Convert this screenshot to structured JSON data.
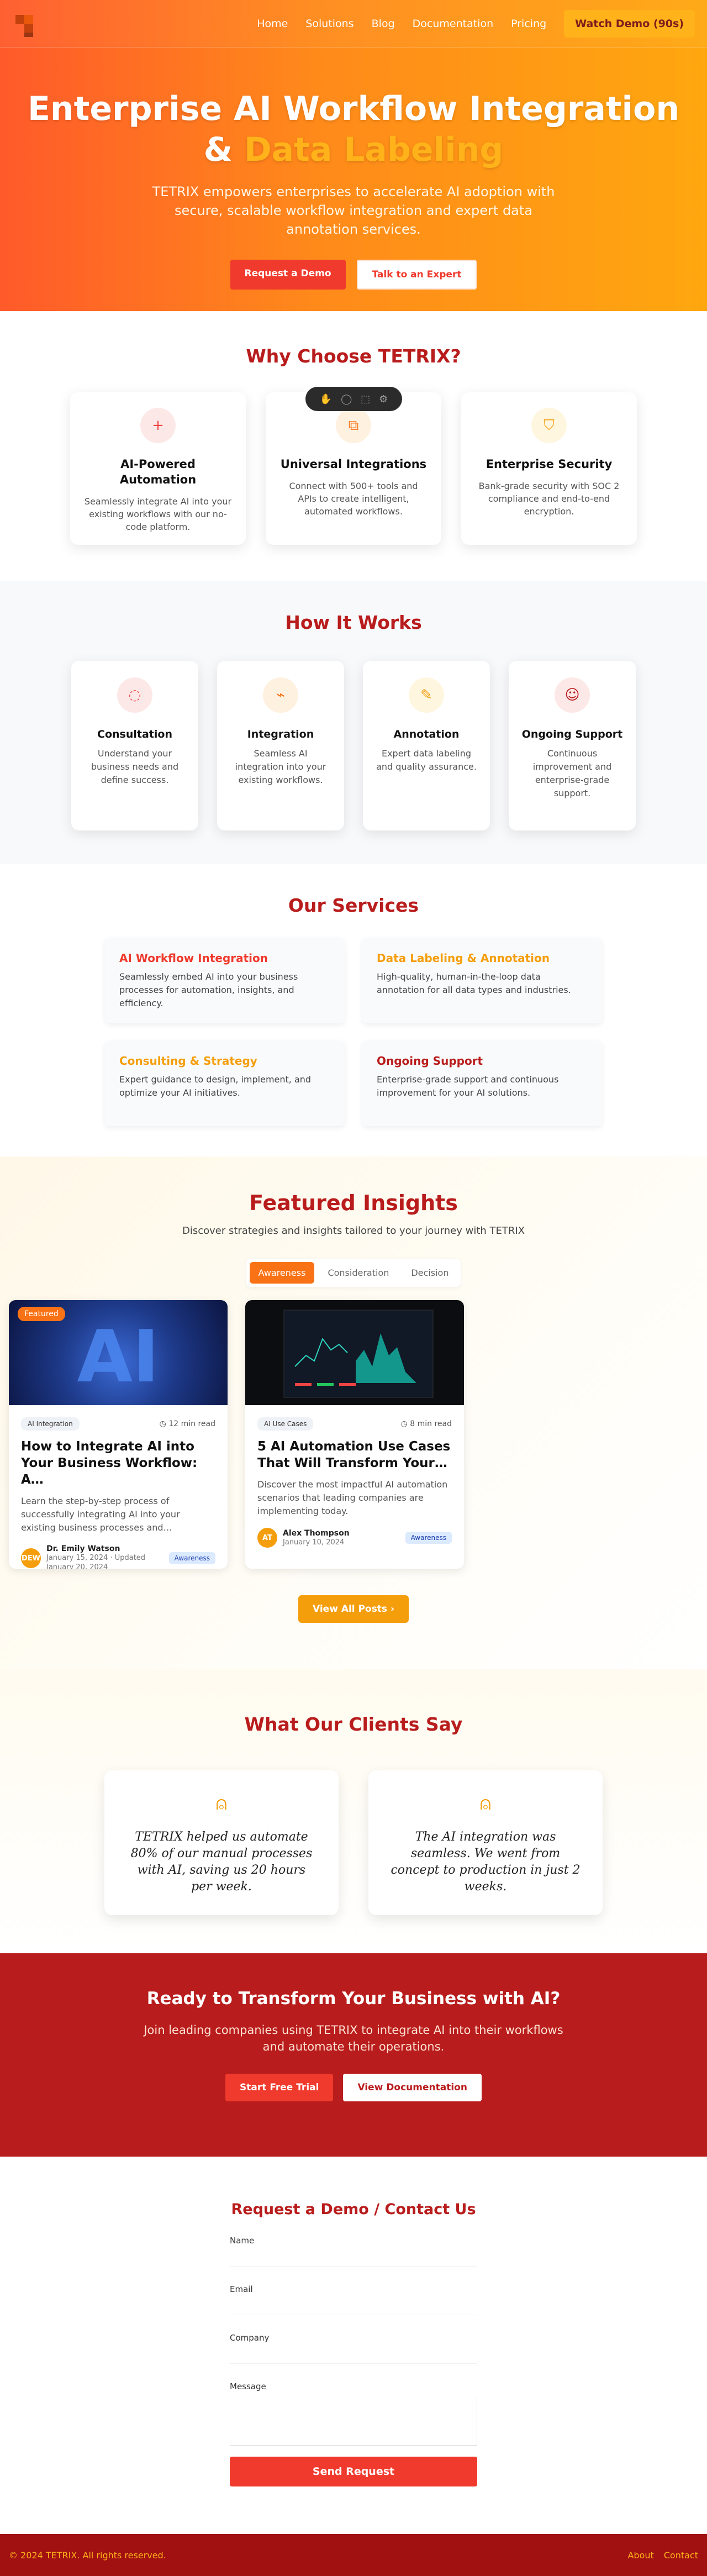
{
  "nav": {
    "links": [
      "Home",
      "Solutions",
      "Blog",
      "Documentation",
      "Pricing"
    ],
    "watch_demo": "Watch Demo (90s)"
  },
  "hero": {
    "title_line1": "Enterprise AI Workflow Integration",
    "title_amp": "&",
    "title_highlight": "Data Labeling",
    "subtitle": "TETRIX empowers enterprises to accelerate AI adoption with secure, scalable workflow integration and expert data annotation services.",
    "btn_primary": "Request a Demo",
    "btn_secondary": "Talk to an Expert"
  },
  "why": {
    "title": "Why Choose TETRIX?",
    "cards": [
      {
        "title": "AI-Powered Automation",
        "text": "Seamlessly integrate AI into your existing workflows with our no-code platform.",
        "icon": "plus-icon",
        "color": "#ef4444",
        "bg": "#fde8e8"
      },
      {
        "title": "Universal Integrations",
        "text": "Connect with 500+ tools and APIs to create intelligent, automated workflows.",
        "icon": "integrations-icon",
        "color": "#f97316",
        "bg": "#fff1e0"
      },
      {
        "title": "Enterprise Security",
        "text": "Bank-grade security with SOC 2 compliance and end-to-end encryption.",
        "icon": "shield-icon",
        "color": "#f59e0b",
        "bg": "#fff6df"
      }
    ]
  },
  "how": {
    "title": "How It Works",
    "steps": [
      {
        "title": "Consultation",
        "text": "Understand your business needs and define success.",
        "icon": "chat-icon",
        "color": "#ef4444",
        "bg": "#fde8e8"
      },
      {
        "title": "Integration",
        "text": "Seamless AI integration into your existing workflows.",
        "icon": "plug-icon",
        "color": "#f97316",
        "bg": "#fff1e0"
      },
      {
        "title": "Annotation",
        "text": "Expert data labeling and quality assurance.",
        "icon": "pencil-icon",
        "color": "#f59e0b",
        "bg": "#fff6df"
      },
      {
        "title": "Ongoing Support",
        "text": "Continuous improvement and enterprise-grade support.",
        "icon": "support-icon",
        "color": "#b91c1c",
        "bg": "#fde8e8"
      }
    ]
  },
  "services": {
    "title": "Our Services",
    "items": [
      {
        "title": "AI Workflow Integration",
        "text": "Seamlessly embed AI into your business processes for automation, insights, and efficiency.",
        "color": "#ef3a2d"
      },
      {
        "title": "Data Labeling & Annotation",
        "text": "High-quality, human-in-the-loop data annotation for all data types and industries.",
        "color": "#f59e0b"
      },
      {
        "title": "Consulting & Strategy",
        "text": "Expert guidance to design, implement, and optimize your AI initiatives.",
        "color": "#f59e0b"
      },
      {
        "title": "Ongoing Support",
        "text": "Enterprise-grade support and continuous improvement for your AI solutions.",
        "color": "#b91c1c"
      }
    ]
  },
  "insights": {
    "title": "Featured Insights",
    "subtitle": "Discover strategies and insights tailored to your journey with TETRIX",
    "tabs": [
      "Awareness",
      "Consideration",
      "Decision"
    ],
    "active_tab": "Awareness",
    "posts": [
      {
        "featured": "Featured",
        "tag": "AI Integration",
        "read": "12 min read",
        "title": "How to Integrate AI into Your Business Workflow: A…",
        "excerpt": "Learn the step-by-step process of successfully integrating AI into your existing business processes and…",
        "author": "Dr. Emily Watson",
        "initials": "DEW",
        "date": "January 15, 2024 · Updated January 20, 2024",
        "badge": "Awareness",
        "img_text": "AI"
      },
      {
        "tag": "AI Use Cases",
        "read": "8 min read",
        "title": "5 AI Automation Use Cases That Will Transform Your…",
        "excerpt": "Discover the most impactful AI automation scenarios that leading companies are implementing today.",
        "author": "Alex Thompson",
        "initials": "AT",
        "date": "January 10, 2024",
        "badge": "Awareness"
      }
    ],
    "view_all": "View All Posts"
  },
  "testimonials": {
    "title": "What Our Clients Say",
    "quotes": [
      "TETRIX helped us automate 80% of our manual processes with AI, saving us 20 hours per week.",
      "The AI integration was seamless. We went from concept to production in just 2 weeks."
    ]
  },
  "cta": {
    "title": "Ready to Transform Your Business with AI?",
    "text": "Join leading companies using TETRIX to integrate AI into their workflows and automate their operations.",
    "btn_trial": "Start Free Trial",
    "btn_docs": "View Documentation"
  },
  "contact": {
    "title": "Request a Demo / Contact Us",
    "labels": [
      "Name",
      "Email",
      "Company",
      "Message"
    ],
    "send": "Send Request"
  },
  "footer": {
    "copyright": "© 2024 TETRIX. All rights reserved.",
    "links": [
      "About",
      "Contact"
    ]
  }
}
